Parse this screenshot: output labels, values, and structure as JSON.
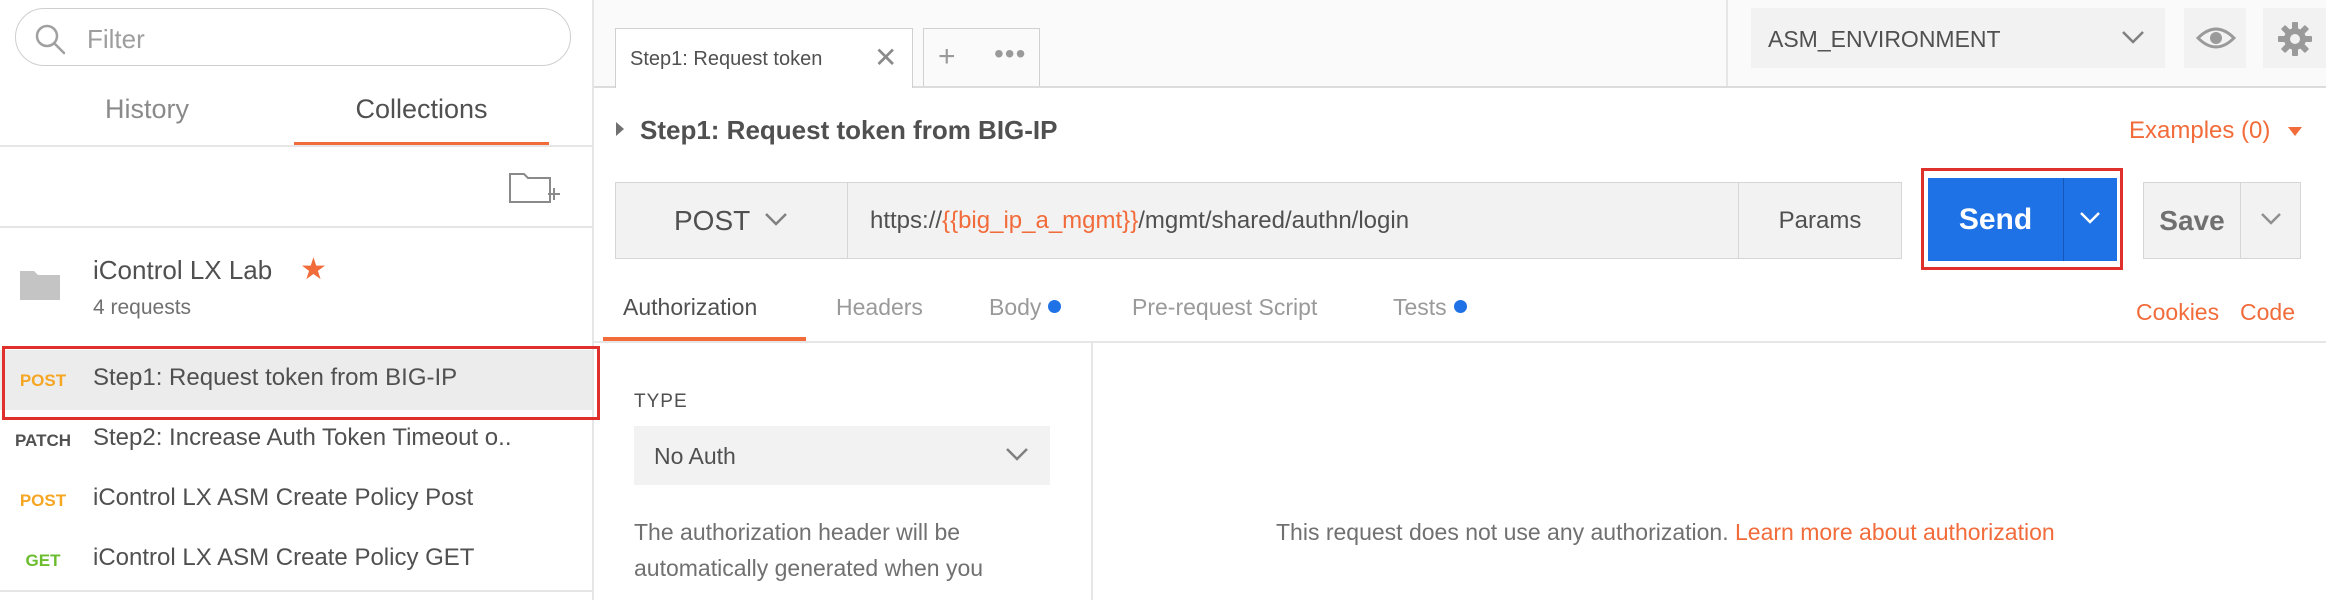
{
  "sidebar": {
    "filter_placeholder": "Filter",
    "tabs": {
      "history": "History",
      "collections": "Collections"
    },
    "collection": {
      "name": "iControl LX Lab",
      "count": "4 requests",
      "starred": true
    },
    "requests": [
      {
        "method": "POST",
        "name": "Step1: Request token from BIG-IP",
        "selected": true
      },
      {
        "method": "PATCH",
        "name": "Step2: Increase Auth Token Timeout o.."
      },
      {
        "method": "POST",
        "name": "iControl LX ASM Create Policy Post"
      },
      {
        "method": "GET",
        "name": "iControl LX ASM Create Policy GET"
      }
    ]
  },
  "tabbar": {
    "active_tab": "Step1: Request token",
    "add_symbol": "+",
    "more_symbol": "•••",
    "close_symbol": "✕"
  },
  "environment": {
    "selected": "ASM_ENVIRONMENT"
  },
  "request": {
    "title": "Step1: Request token from BIG-IP",
    "examples": "Examples (0)",
    "method": "POST",
    "url_prefix": "https://",
    "url_variable": "{{big_ip_a_mgmt}}",
    "url_suffix": "/mgmt/shared/authn/login",
    "params": "Params",
    "send": "Send",
    "save": "Save"
  },
  "request_tabs": {
    "authorization": "Authorization",
    "headers": "Headers",
    "body": "Body",
    "prerequest": "Pre-request Script",
    "tests": "Tests",
    "cookies": "Cookies",
    "code": "Code"
  },
  "auth": {
    "type_label": "TYPE",
    "type_value": "No Auth",
    "description": "The authorization header will be automatically generated when you",
    "message": "This request does not use any authorization.",
    "learn_more": "Learn more about authorization"
  },
  "colors": {
    "accent": "#f26b3a",
    "send_blue": "#1f72e5",
    "highlight_red": "#e0302b",
    "post": "#f5a623",
    "get": "#6bbd2e"
  }
}
